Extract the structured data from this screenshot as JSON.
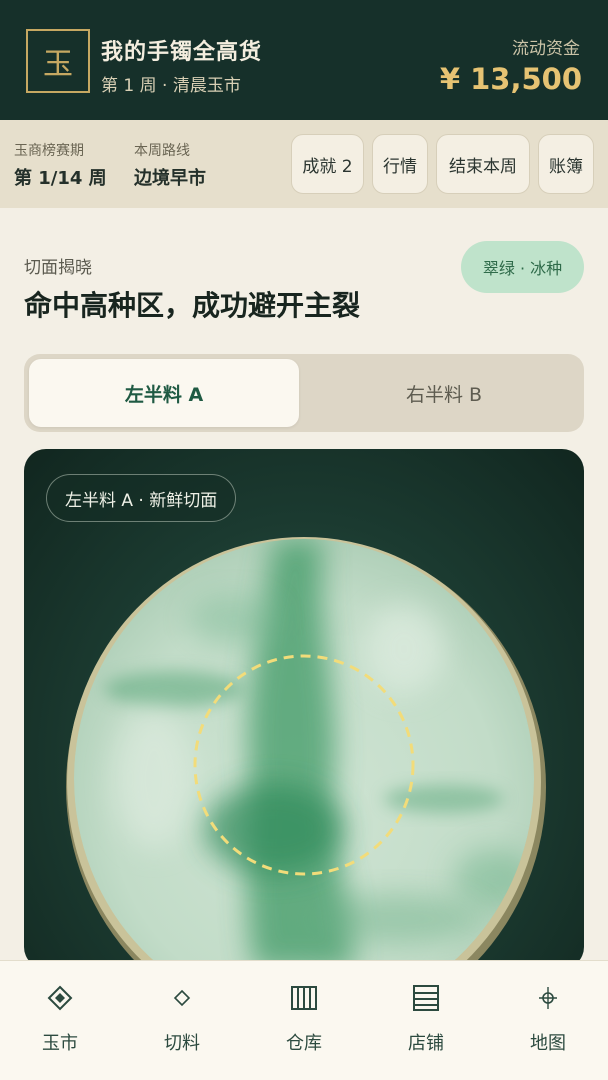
{
  "header": {
    "logo_char": "玉",
    "title": "我的手镯全高货",
    "subtitle": "第 1 周 · 清晨玉市",
    "fund_label": "流动资金",
    "fund_value": "¥ 13,500"
  },
  "infobar": {
    "season_label": "玉商榜赛期",
    "season_value": "第 1/14 周",
    "route_label": "本周路线",
    "route_value": "边境早市",
    "buttons": [
      "成就 2",
      "行情",
      "结束本周",
      "账簿"
    ]
  },
  "reveal": {
    "section_label": "切面揭晓",
    "headline": "命中高种区，成功避开主裂",
    "badge": "翠绿 · 冰种"
  },
  "toggle": {
    "left": "左半料 A",
    "right": "右半料 B",
    "selected": "left"
  },
  "stone": {
    "chip": "左半料 A · 新鲜切面"
  },
  "nav": [
    {
      "label": "玉市",
      "icon": "diamond-icon"
    },
    {
      "label": "切料",
      "icon": "small-diamond-icon"
    },
    {
      "label": "仓库",
      "icon": "warehouse-icon"
    },
    {
      "label": "店铺",
      "icon": "list-icon"
    },
    {
      "label": "地图",
      "icon": "map-pin-icon"
    }
  ],
  "colors": {
    "header_bg": "#16302a",
    "accent_gold": "#e6c373",
    "badge_bg": "#bfe3cb",
    "jade_green": "#2f8a5a"
  }
}
